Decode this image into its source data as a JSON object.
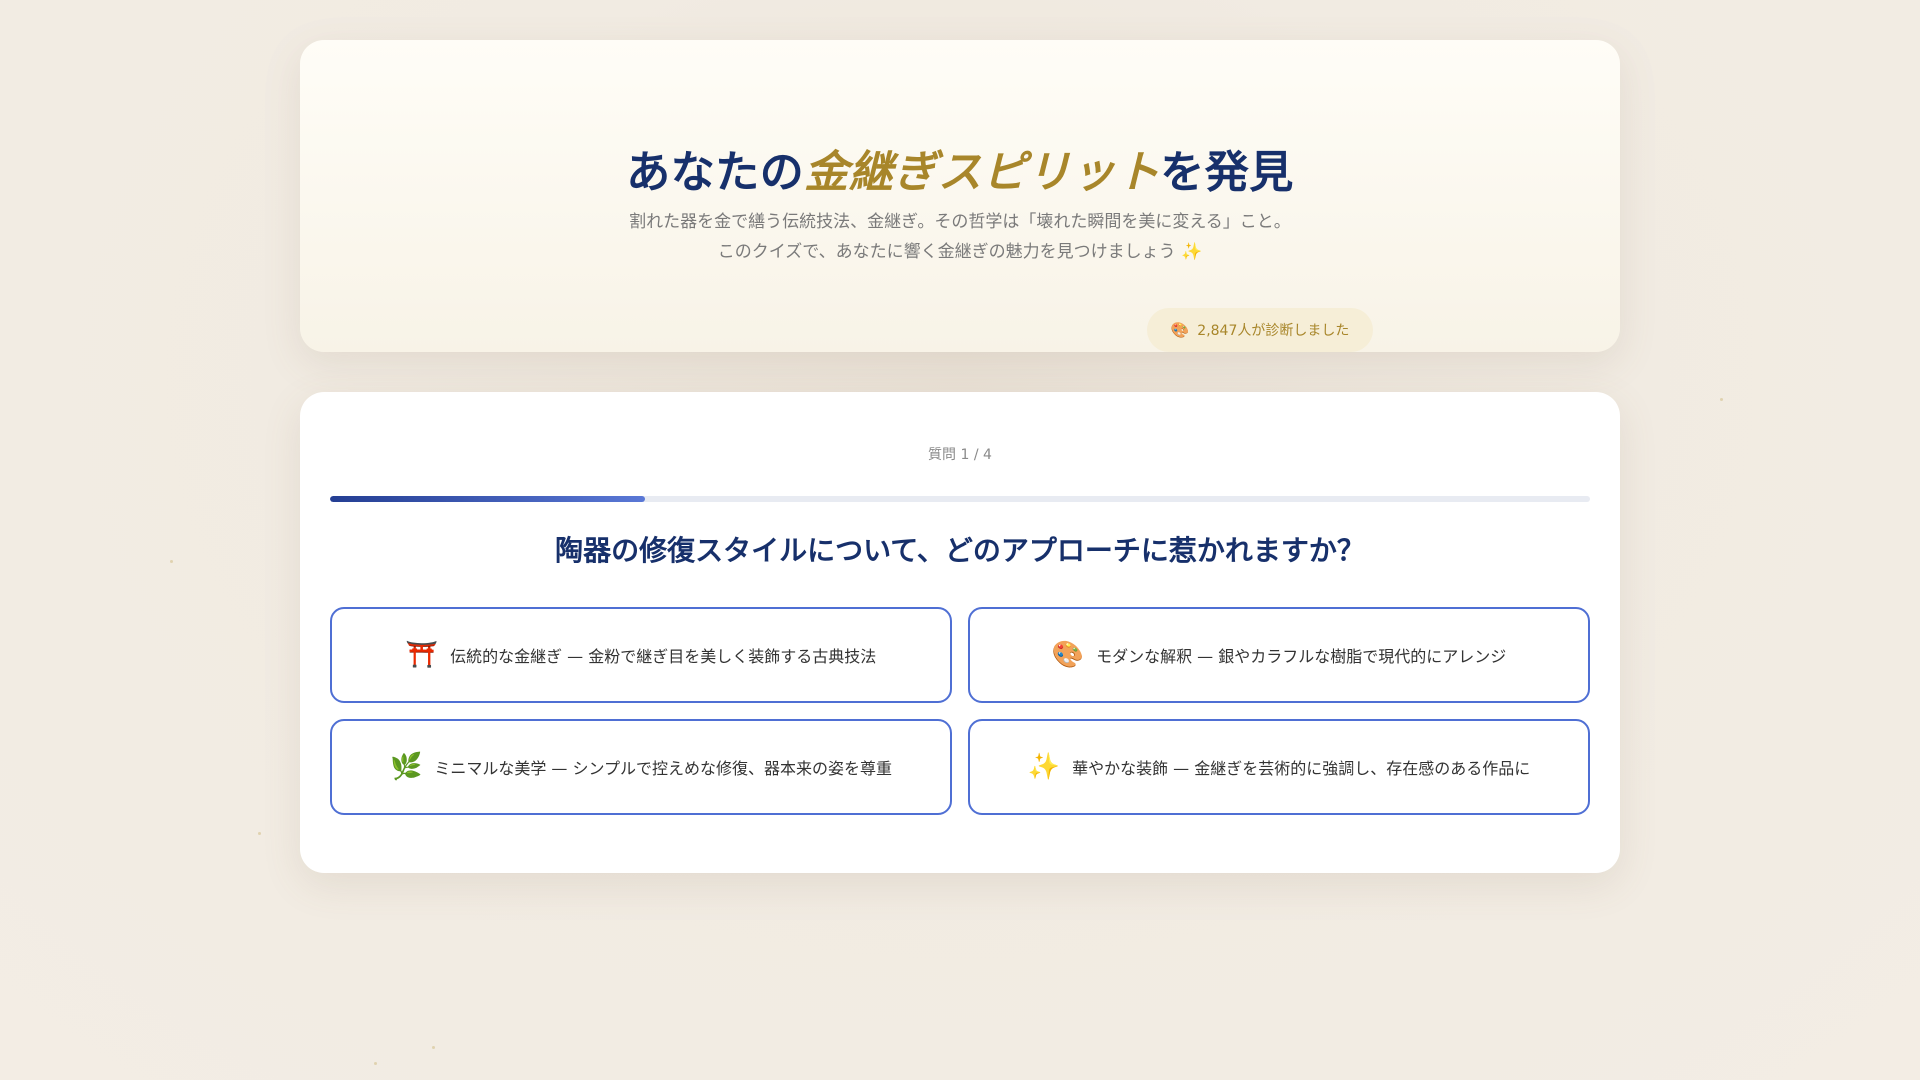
{
  "hero": {
    "title_before": "あなたの",
    "title_highlight": "金継ぎスピリット",
    "title_after": "を発見",
    "description_line1": "割れた器を金で繕う伝統技法、金継ぎ。その哲学は「壊れた瞬間を美に変える」こと。",
    "description_line2": "このクイズで、あなたに響く金継ぎの魅力を見つけましょう ✨",
    "badge_icon": "palette-icon",
    "badge_glyph": "🎨",
    "badge_text": "2,847人が診断しました"
  },
  "quiz": {
    "counter": "質問 1 / 4",
    "progress": 0.25,
    "question": "陶器の修復スタイルについて、どのアプローチに惹かれますか？",
    "options": [
      {
        "icon": "torii-icon",
        "glyph": "⛩️",
        "label": "伝統的な金継ぎ — 金粉で継ぎ目を美しく装飾する古典技法"
      },
      {
        "icon": "palette-icon",
        "glyph": "🎨",
        "label": "モダンな解釈 — 銀やカラフルな樹脂で現代的にアレンジ"
      },
      {
        "icon": "leaf-icon",
        "glyph": "🌿",
        "label": "ミニマルな美学 — シンプルで控えめな修復、器本来の姿を尊重"
      },
      {
        "icon": "sparkles-icon",
        "glyph": "✨",
        "label": "華やかな装飾 — 金継ぎを芸術的に強調し、存在感のある作品に"
      }
    ]
  },
  "colors": {
    "navy": "#17306b",
    "gold": "#a8862a",
    "accent_blue": "#4f6fd4",
    "background": "#f1ebe2"
  }
}
